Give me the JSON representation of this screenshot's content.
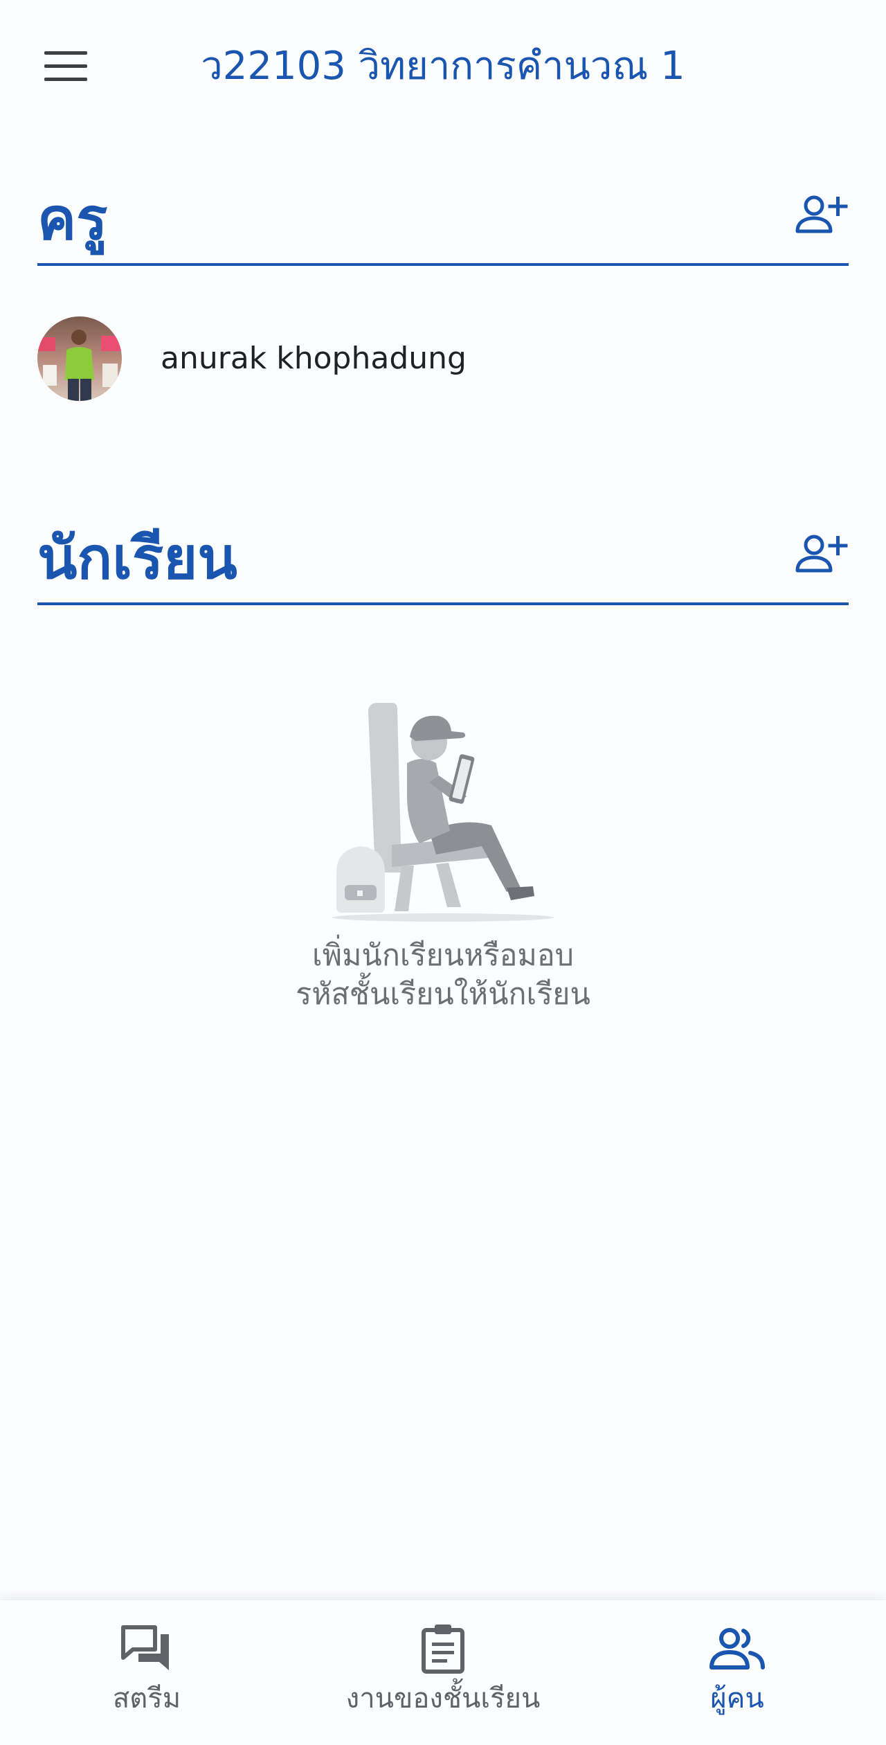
{
  "header": {
    "title": "ว22103 วิทยาการคำนวณ 1",
    "menu_icon": "hamburger-menu-icon"
  },
  "teachers_section": {
    "title": "ครู",
    "add_icon": "add-person-icon",
    "items": [
      {
        "name": "anurak khophadung",
        "avatar": "teacher-avatar-photo"
      }
    ]
  },
  "students_section": {
    "title": "นักเรียน",
    "add_icon": "add-person-icon",
    "empty_state": {
      "illustration": "student-reading-tablet-illustration",
      "line1": "เพิ่มนักเรียนหรือมอบ",
      "line2": "รหัสชั้นเรียนให้นักเรียน"
    }
  },
  "bottom_nav": {
    "items": [
      {
        "label": "สตรีม",
        "icon": "chat-bubbles-icon",
        "active": false
      },
      {
        "label": "งานของชั้นเรียน",
        "icon": "clipboard-icon",
        "active": false
      },
      {
        "label": "ผู้คน",
        "icon": "people-icon",
        "active": true
      }
    ]
  },
  "colors": {
    "accent": "#1a56b0",
    "text_primary": "#202124",
    "text_secondary": "#5f6368",
    "background": "#fcfdfe"
  }
}
